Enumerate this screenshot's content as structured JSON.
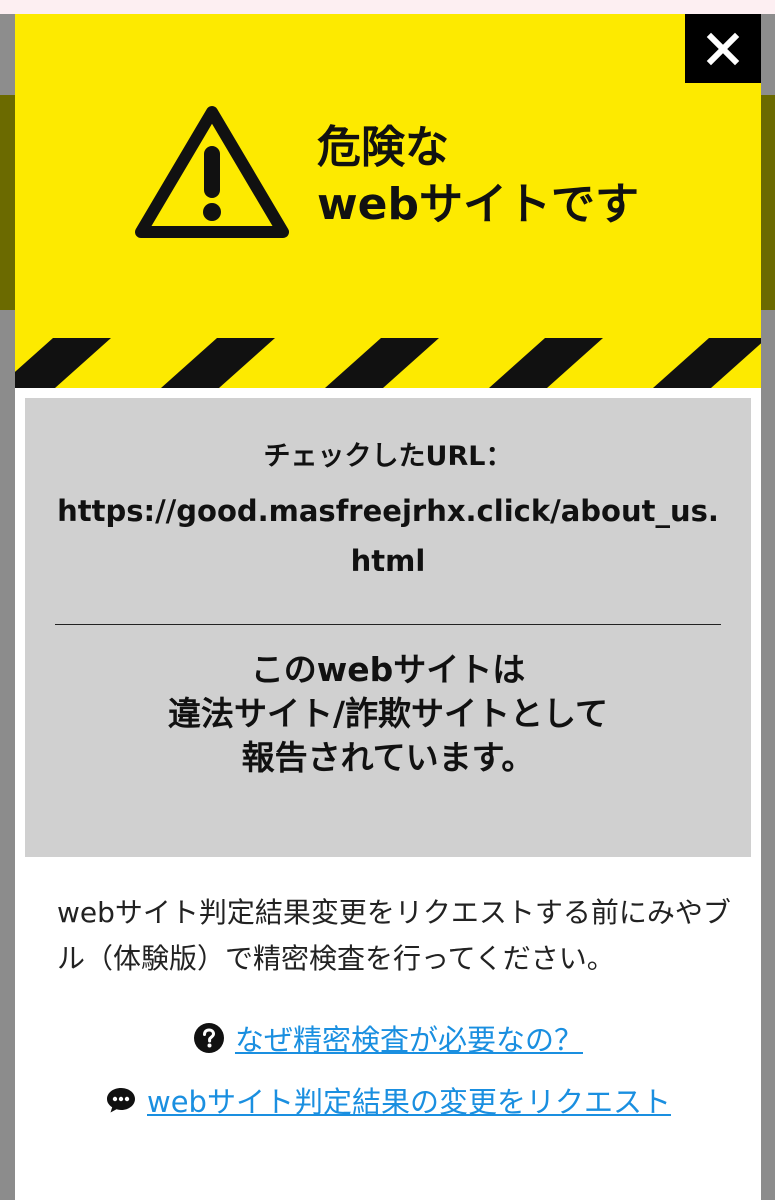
{
  "dialog": {
    "close_symbol": "✕",
    "title_line1": "危険な",
    "title_line2": "webサイトです",
    "url_label": "チェックしたURL：",
    "url_value": "https://good.masfreejrhx.click/about_us.html",
    "verdict_line1": "このwebサイトは",
    "verdict_line2": "違法サイト/詐欺サイトとして",
    "verdict_line3": "報告されています。",
    "instructions": "webサイト判定結果変更をリクエストする前にみやブル（体験版）で精密検査を行ってください。",
    "link_why": "なぜ精密検査が必要なの？",
    "link_request": "webサイト判定結果の変更をリクエスト",
    "icons": {
      "warning": "warning-triangle-icon",
      "close": "close-icon",
      "question": "question-circle-icon",
      "chat": "chat-bubble-icon"
    }
  },
  "colors": {
    "header_yellow": "#fdea00",
    "result_gray": "#d0d0d0",
    "link_blue": "#1a8fe0",
    "dark": "#111111"
  }
}
